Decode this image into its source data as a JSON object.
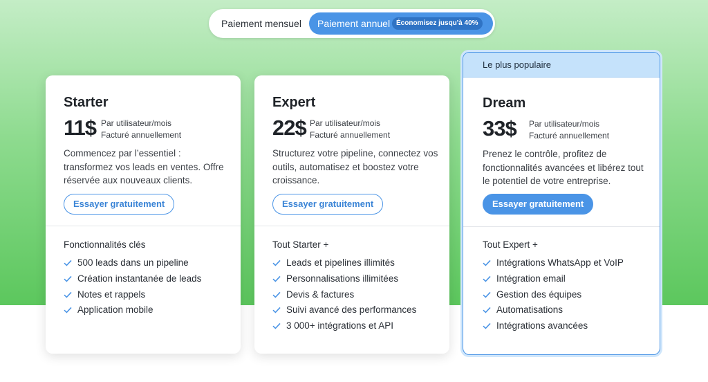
{
  "billing_toggle": {
    "monthly_label": "Paiement mensuel",
    "annual_label": "Paiement annuel",
    "savings_badge": "Économisez jusqu'à 40%"
  },
  "colors": {
    "accent_blue": "#4a94e6",
    "background_green": "#5cc75d",
    "popular_ribbon": "#c5e2fb"
  },
  "plans": [
    {
      "name": "Starter",
      "price": "11$",
      "price_unit": "Par utilisateur/mois",
      "billing": "Facturé annuellement",
      "description": "Commencez par l’essentiel : transformez vos leads en ventes. Offre réservée aux nouveaux clients.",
      "cta": "Essayer gratuitement",
      "features_title": "Fonctionnalités clés",
      "features": [
        "500 leads dans un pipeline",
        "Création instantanée de leads",
        "Notes et rappels",
        "Application mobile"
      ]
    },
    {
      "name": "Expert",
      "price": "22$",
      "price_unit": "Par utilisateur/mois",
      "billing": "Facturé annuellement",
      "description": "Structurez votre pipeline, connectez vos outils, automatisez et boostez votre croissance.",
      "cta": "Essayer gratuitement",
      "features_title": "Tout Starter +",
      "features": [
        "Leads et pipelines illimités",
        "Personnalisations illimitées",
        "Devis & factures",
        "Suivi avancé des performances",
        "3 000+ intégrations et API"
      ]
    },
    {
      "name": "Dream",
      "badge": "Le plus populaire",
      "price": "33$",
      "price_unit": "Par utilisateur/mois",
      "billing": "Facturé annuellement",
      "description": "Prenez le contrôle, profitez de fonctionnalités avancées et libérez tout le potentiel de votre entreprise.",
      "cta": "Essayer gratuitement",
      "features_title": "Tout Expert +",
      "features": [
        "Intégrations WhatsApp et VoIP",
        "Intégration email",
        "Gestion des équipes",
        "Automatisations",
        "Intégrations avancées"
      ]
    }
  ]
}
